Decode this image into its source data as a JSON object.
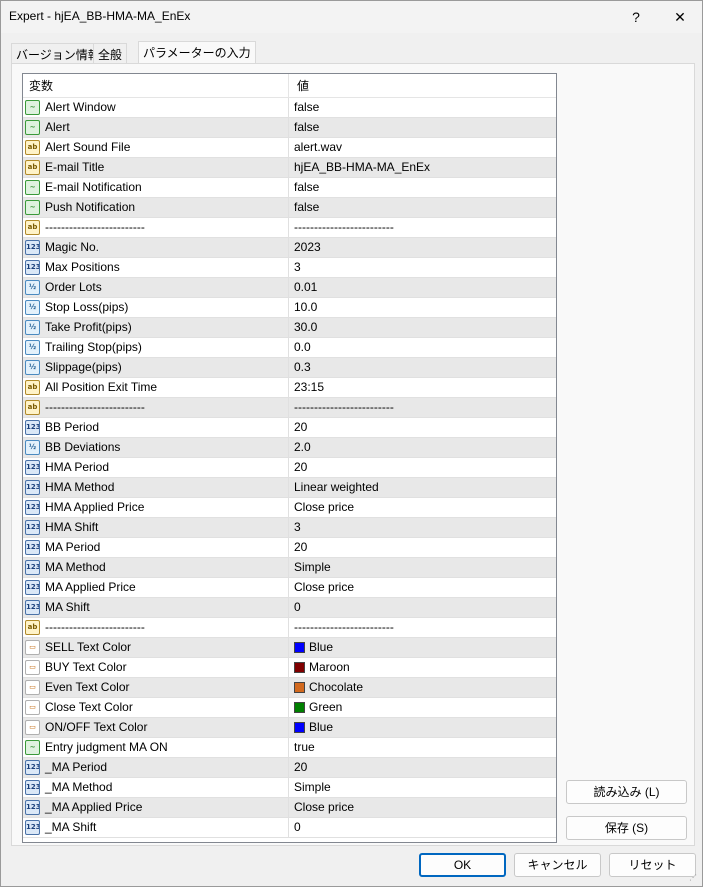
{
  "window": {
    "title": "Expert - hjEA_BB-HMA-MA_EnEx",
    "help_label": "?",
    "close_label": "✕"
  },
  "tabs": [
    {
      "label": "バージョン情報",
      "active": false
    },
    {
      "label": "全般",
      "active": false
    },
    {
      "label": "パラメーターの入力",
      "active": true
    }
  ],
  "grid": {
    "columns": [
      "変数",
      "値"
    ],
    "rows": [
      {
        "icon": "bool",
        "name": "Alert Window",
        "value": "false"
      },
      {
        "icon": "bool",
        "name": "Alert",
        "value": "false"
      },
      {
        "icon": "str",
        "name": "Alert Sound File",
        "value": "alert.wav"
      },
      {
        "icon": "str",
        "name": "E-mail Title",
        "value": "hjEA_BB-HMA-MA_EnEx"
      },
      {
        "icon": "bool",
        "name": "E-mail Notification",
        "value": "false"
      },
      {
        "icon": "bool",
        "name": "Push Notification",
        "value": "false"
      },
      {
        "icon": "str",
        "name": "-------------------------",
        "value": "-------------------------"
      },
      {
        "icon": "int",
        "name": "Magic No.",
        "value": "2023"
      },
      {
        "icon": "int",
        "name": "Max Positions",
        "value": "3"
      },
      {
        "icon": "dbl",
        "name": "Order Lots",
        "value": "0.01"
      },
      {
        "icon": "dbl",
        "name": "Stop Loss(pips)",
        "value": "10.0"
      },
      {
        "icon": "dbl",
        "name": "Take Profit(pips)",
        "value": "30.0"
      },
      {
        "icon": "dbl",
        "name": "Trailing Stop(pips)",
        "value": "0.0"
      },
      {
        "icon": "dbl",
        "name": "Slippage(pips)",
        "value": "0.3"
      },
      {
        "icon": "str",
        "name": "All Position Exit Time",
        "value": "23:15"
      },
      {
        "icon": "str",
        "name": "-------------------------",
        "value": "-------------------------"
      },
      {
        "icon": "int",
        "name": "BB Period",
        "value": "20"
      },
      {
        "icon": "dbl",
        "name": "BB Deviations",
        "value": "2.0"
      },
      {
        "icon": "int",
        "name": "HMA Period",
        "value": "20"
      },
      {
        "icon": "int",
        "name": "HMA Method",
        "value": "Linear weighted"
      },
      {
        "icon": "int",
        "name": "HMA Applied Price",
        "value": "Close price"
      },
      {
        "icon": "int",
        "name": "HMA Shift",
        "value": "3"
      },
      {
        "icon": "int",
        "name": "MA Period",
        "value": "20"
      },
      {
        "icon": "int",
        "name": "MA Method",
        "value": "Simple"
      },
      {
        "icon": "int",
        "name": "MA Applied Price",
        "value": "Close price"
      },
      {
        "icon": "int",
        "name": "MA Shift",
        "value": "0"
      },
      {
        "icon": "str",
        "name": "-------------------------",
        "value": "-------------------------"
      },
      {
        "icon": "col",
        "name": "SELL  Text Color",
        "value": "Blue",
        "swatch": "#0000ff"
      },
      {
        "icon": "col",
        "name": "BUY   Text Color",
        "value": "Maroon",
        "swatch": "#800000"
      },
      {
        "icon": "col",
        "name": "Even  Text Color",
        "value": "Chocolate",
        "swatch": "#d2691e"
      },
      {
        "icon": "col",
        "name": "Close Text Color",
        "value": "Green",
        "swatch": "#008000"
      },
      {
        "icon": "col",
        "name": "ON/OFF Text Color",
        "value": "Blue",
        "swatch": "#0000ff"
      },
      {
        "icon": "bool",
        "name": "Entry judgment MA ON",
        "value": "true"
      },
      {
        "icon": "int",
        "name": "_MA Period",
        "value": "20"
      },
      {
        "icon": "int",
        "name": "_MA Method",
        "value": "Simple"
      },
      {
        "icon": "int",
        "name": "_MA Applied Price",
        "value": "Close price"
      },
      {
        "icon": "int",
        "name": "_MA Shift",
        "value": "0"
      }
    ]
  },
  "icons": {
    "bool": {
      "name": "bool-param-icon",
      "glyph": "~"
    },
    "str": {
      "name": "string-param-icon",
      "glyph": "ab"
    },
    "int": {
      "name": "integer-param-icon",
      "glyph": "123"
    },
    "dbl": {
      "name": "double-param-icon",
      "glyph": "½"
    },
    "col": {
      "name": "color-param-icon",
      "glyph": "▭"
    }
  },
  "buttons": {
    "load": "読み込み (L)",
    "save": "保存 (S)",
    "ok": "OK",
    "cancel": "キャンセル",
    "reset": "リセット"
  }
}
